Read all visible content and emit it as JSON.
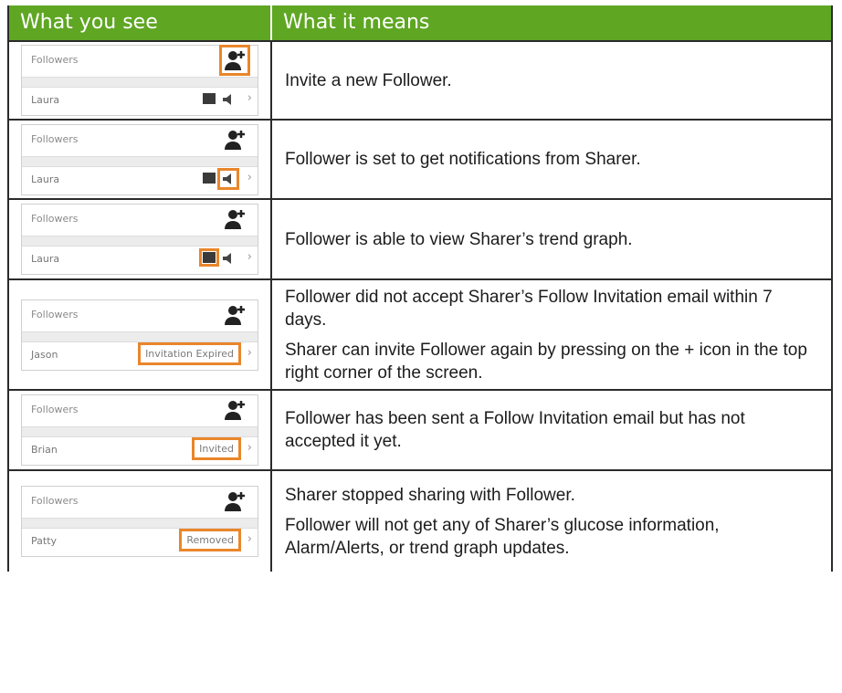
{
  "header": {
    "col1": "What you see",
    "col2": "What it means"
  },
  "rows": [
    {
      "title": "Followers",
      "name": "Laura",
      "desc": [
        "Invite a new Follower."
      ]
    },
    {
      "title": "Followers",
      "name": "Laura",
      "desc": [
        "Follower is set to get notifications from Sharer."
      ]
    },
    {
      "title": "Followers",
      "name": "Laura",
      "desc": [
        "Follower is able to view Sharer’s trend graph."
      ]
    },
    {
      "title": "Followers",
      "name": "Jason",
      "status": "Invitation Expired",
      "desc": [
        "Follower did not accept Sharer’s Follow Invitation email within 7 days.",
        "Sharer can invite Follower again by pressing on the + icon in the top right corner of the screen."
      ]
    },
    {
      "title": "Followers",
      "name": "Brian",
      "status": "Invited",
      "desc": [
        "Follower has been sent a Follow Invitation email but has not accepted it yet."
      ]
    },
    {
      "title": "Followers",
      "name": "Patty",
      "status": "Removed",
      "desc": [
        "Sharer stopped sharing with Follower.",
        "Follower will not get any of Sharer’s glucose information, Alarm/Alerts, or trend graph updates."
      ]
    }
  ],
  "colors": {
    "header": "#5fa623",
    "highlight": "#e9862b"
  },
  "icons": {
    "add": "add-person-icon",
    "notify": "speaker-icon",
    "graph": "trend-graph-icon",
    "chevron": "chevron-right-icon"
  }
}
